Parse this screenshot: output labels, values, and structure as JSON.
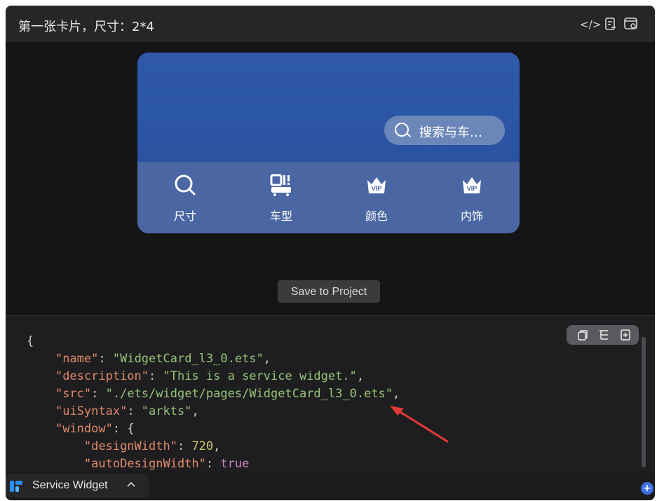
{
  "title": "第一张卡片，尺寸：2*4",
  "toolbar": {
    "icons": [
      "code-icon",
      "document-list-icon",
      "preview-settings-icon"
    ],
    "code_glyph": "</>"
  },
  "card": {
    "search_text": "搜索与车…",
    "entries": [
      {
        "label": "尺寸",
        "icon": "search-icon"
      },
      {
        "label": "车型",
        "icon": "car-model-icon"
      },
      {
        "label": "颜色",
        "icon": "vip-crown-icon"
      },
      {
        "label": "内饰",
        "icon": "vip-crown-icon"
      }
    ],
    "vip_text": "VIP",
    "colors": {
      "top": "#2f58a8",
      "bottom": "#4a66a3"
    }
  },
  "save_button": "Save to Project",
  "code_lines": [
    "{",
    "    \"name\": \"WidgetCard_l3_0.ets\",",
    "    \"description\": \"This is a service widget.\",",
    "    \"src\": \"./ets/widget/pages/WidgetCard_l3_0.ets\",",
    "    \"uiSyntax\": \"arkts\",",
    "    \"window\": {",
    "        \"designWidth\": 720,",
    "        \"autoDesignWidth\": true"
  ],
  "code_tools": [
    "copy-icon",
    "tree-icon",
    "insert-file-icon"
  ],
  "statusbar": {
    "tab_label": "Service Widget",
    "plus": "+"
  }
}
